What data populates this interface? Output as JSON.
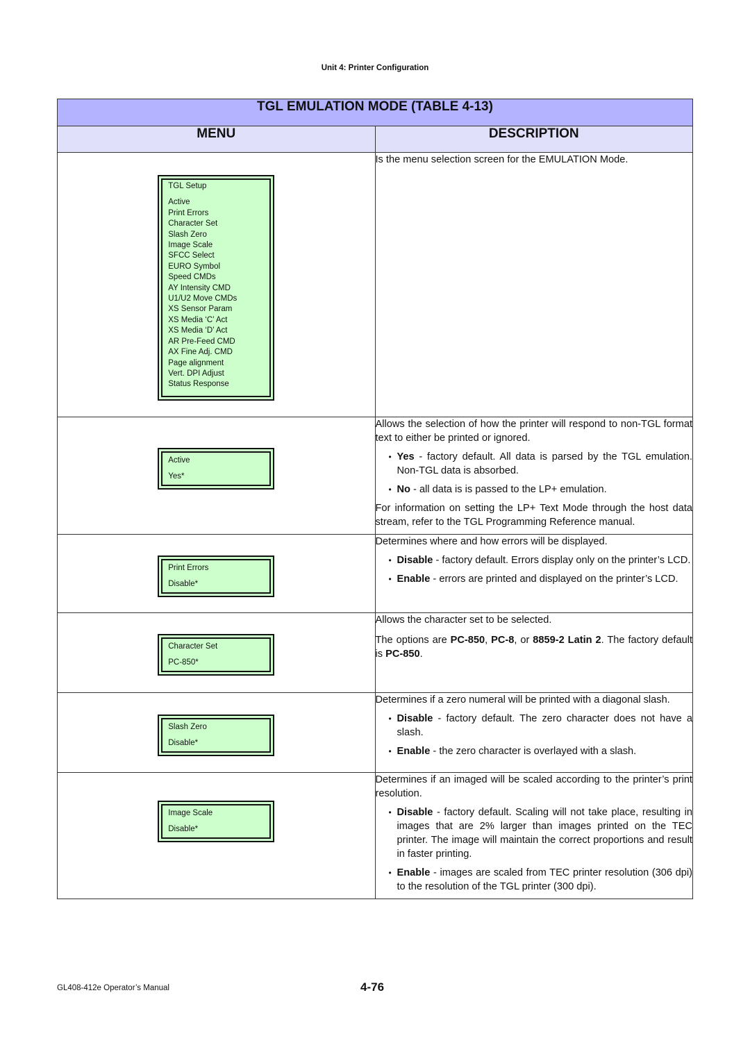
{
  "header": {
    "unit": "Unit 4:  Printer Configuration"
  },
  "table": {
    "title": "TGL EMULATION MODE (TABLE 4-13)",
    "col_menu": "MENU",
    "col_description": "DESCRIPTION",
    "rows": [
      {
        "lcd_title": "TGL Setup",
        "lcd_items": [
          "Active",
          "Print Errors",
          "Character Set",
          "Slash Zero",
          "Image Scale",
          "SFCC Select",
          "EURO Symbol",
          "Speed CMDs",
          "AY Intensity CMD",
          "U1/U2 Move CMDs",
          "XS Sensor Param",
          "XS Media ‘C’ Act",
          "XS Media ‘D’ Act",
          "AR Pre-Feed CMD",
          "AX Fine Adj. CMD",
          "Page alignment",
          "Vert. DPI Adjust",
          "Status Response"
        ],
        "description": "Is the menu selection screen for the EMULATION Mode."
      },
      {
        "lcd_title": "Active",
        "lcd_value": "Yes*",
        "intro": "Allows the selection of how the printer will respond to non-TGL format text to either be printed or ignored.",
        "bullets": [
          {
            "term": "Yes",
            "text": " - factory default. All data is parsed by the TGL emulation. Non-TGL data is absorbed."
          },
          {
            "term": "No",
            "text": " - all data is is passed to the LP+ emulation."
          }
        ],
        "outro": "For information on setting the LP+ Text Mode through the host data stream, refer to the TGL Programming Reference manual."
      },
      {
        "lcd_title": "Print Errors",
        "lcd_value": "Disable*",
        "intro": "Determines where and how errors will be displayed.",
        "bullets": [
          {
            "term": "Disable",
            "text": " - factory default. Errors display only on the printer’s LCD."
          },
          {
            "term": "Enable",
            "text": " - errors are printed and displayed on the printer’s LCD."
          }
        ]
      },
      {
        "lcd_title": "Character Set",
        "lcd_value": "PC-850*",
        "intro": "Allows the character set to be selected.",
        "options_parts": {
          "p1": "The options are ",
          "o1": "PC-850",
          "p2": ", ",
          "o2": "PC-8",
          "p3": ", or ",
          "o3": "8859-2 Latin 2",
          "p4": ". The factory default is ",
          "o4": "PC-850",
          "p5": "."
        }
      },
      {
        "lcd_title": "Slash Zero",
        "lcd_value": "Disable*",
        "intro": "Determines if a zero numeral will be printed with a diagonal slash.",
        "bullets": [
          {
            "term": "Disable",
            "text": " - factory default. The zero character does not have a slash."
          },
          {
            "term": "Enable",
            "text": " - the zero character is overlayed with a slash."
          }
        ]
      },
      {
        "lcd_title": "Image Scale",
        "lcd_value": "Disable*",
        "intro": "Determines if an imaged will be scaled according to the printer’s print resolution.",
        "bullets": [
          {
            "term": "Disable",
            "text": " - factory default. Scaling will not take place, resulting in images that are 2% larger than images printed on the TEC printer. The image will maintain the correct proportions and result in faster printing."
          },
          {
            "term": "Enable",
            "text": " - images are scaled from TEC printer resolution (306 dpi) to the resolution of the TGL printer (300 dpi)."
          }
        ]
      }
    ]
  },
  "footer": {
    "manual": "GL408-412e Operator’s Manual",
    "page": "4-76"
  }
}
